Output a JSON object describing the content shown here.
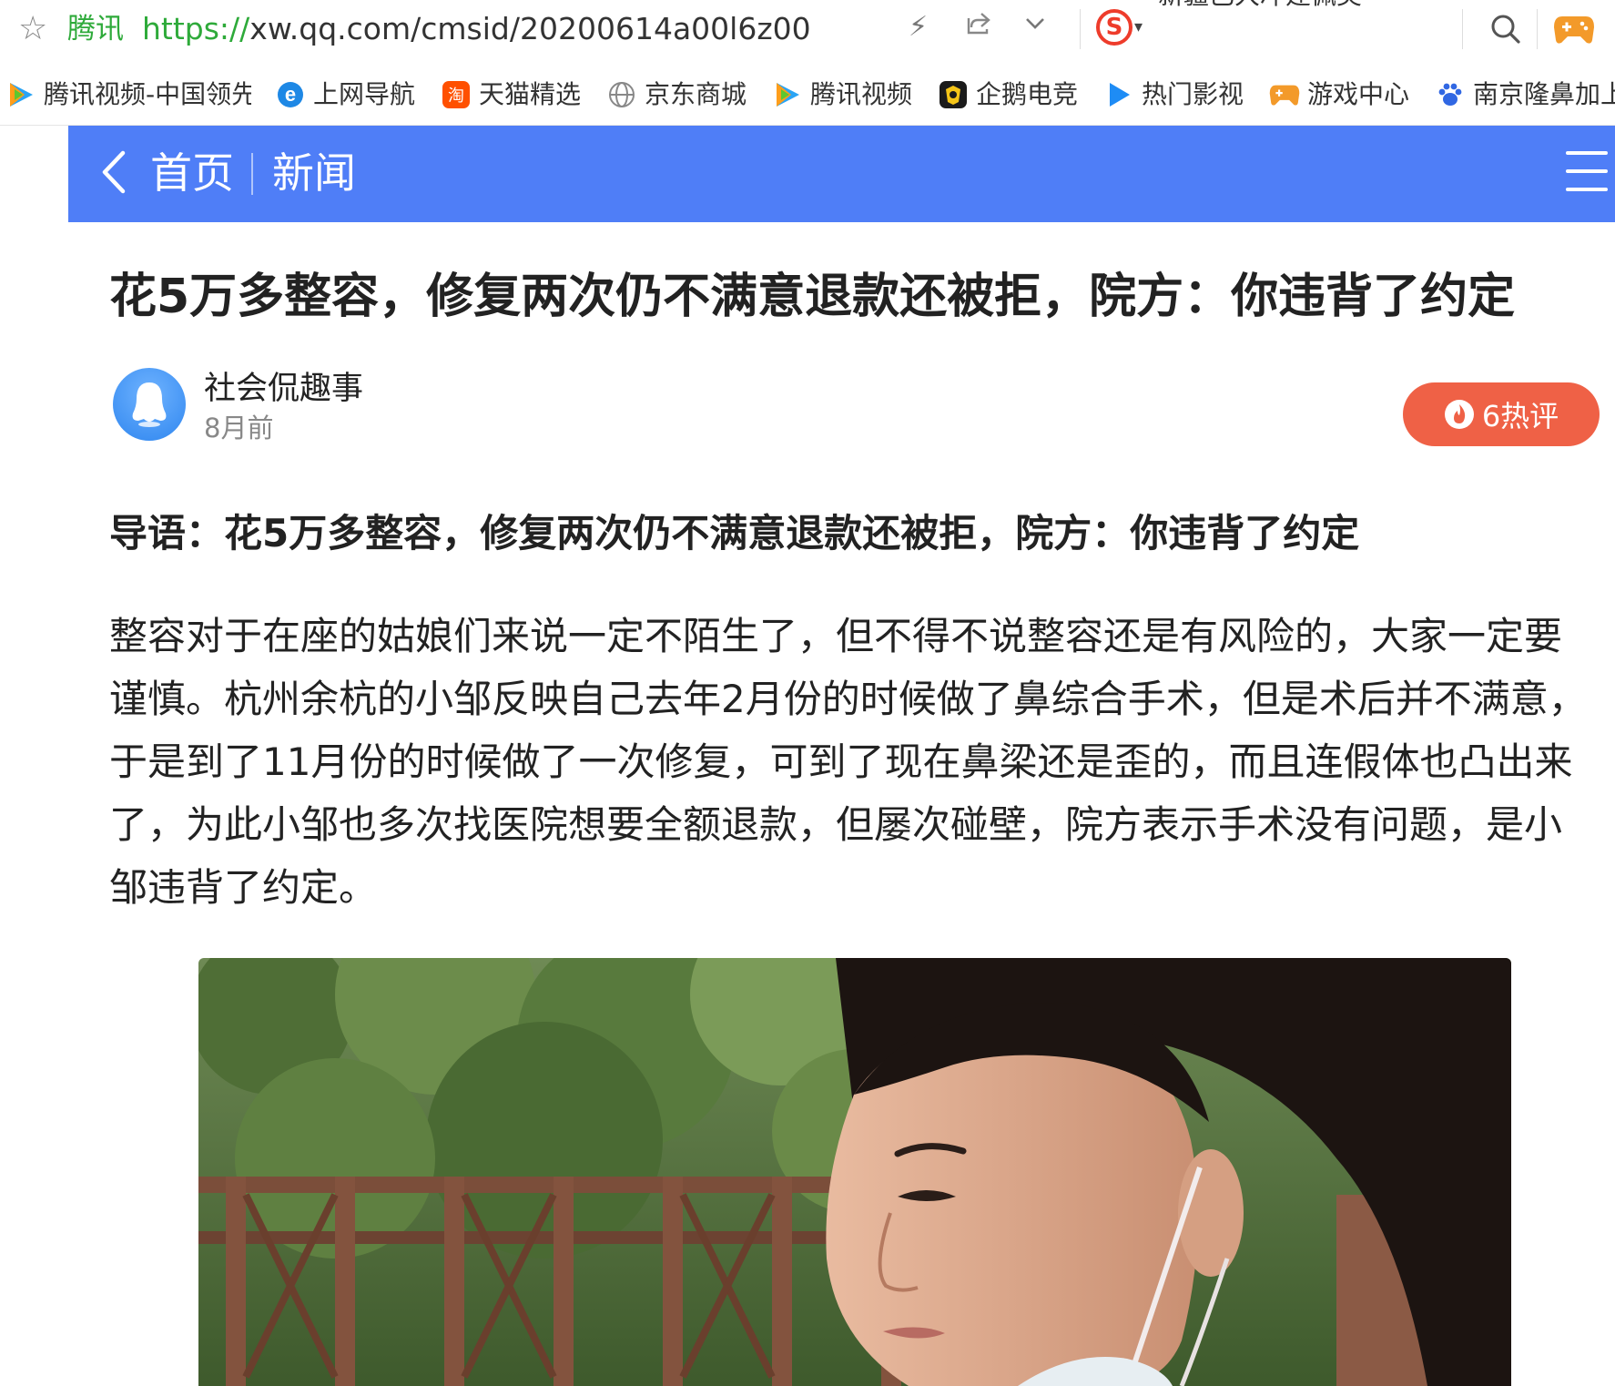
{
  "browser": {
    "site_name": "腾讯",
    "url_proto": "https://",
    "url_rest": "xw.qq.com/cmsid/20200614a00l6z00",
    "clipped_search_hint": "新疆已大冲建佩美"
  },
  "bookmarks": [
    {
      "label": "腾讯视频-中国领先",
      "icon": "tencent-video-icon"
    },
    {
      "label": "上网导航",
      "icon": "ie-icon"
    },
    {
      "label": "天猫精选",
      "icon": "taobao-icon"
    },
    {
      "label": "京东商城",
      "icon": "globe-icon"
    },
    {
      "label": "腾讯视频",
      "icon": "tencent-video-icon"
    },
    {
      "label": "企鹅电竞",
      "icon": "penguin-esports-icon"
    },
    {
      "label": "热门影视",
      "icon": "play-icon"
    },
    {
      "label": "游戏中心",
      "icon": "gamepad-icon"
    },
    {
      "label": "南京隆鼻加上",
      "icon": "baidu-paw-icon"
    }
  ],
  "nav": {
    "home": "首页",
    "section": "新闻"
  },
  "article": {
    "title": "花5万多整容，修复两次仍不满意退款还被拒，院方：你违背了约定",
    "author": "社会侃趣事",
    "time": "8月前",
    "hot_comments": "6热评",
    "lead": "导语：花5万多整容，修复两次仍不满意退款还被拒，院方：你违背了约定",
    "paragraph_lines": [
      "整容对于在座的姑娘们来说一定不陌生了，但不得不说整容还是有风险的，大家一定要",
      "谨慎。杭州余杭的小邹反映自己去年2月份的时候做了鼻综合手术，但是术后并不满意，",
      "于是到了11月份的时候做了一次修复，可到了现在鼻梁还是歪的，而且连假体也凸出来",
      "了，为此小邹也多次找医院想要全额退款，但屡次碰壁，院方表示手术没有问题，是小",
      "邹违背了约定。"
    ]
  },
  "colors": {
    "nav_blue": "#4f7ef7",
    "hot_red": "#ef6146",
    "url_green": "#2eaa3a"
  }
}
